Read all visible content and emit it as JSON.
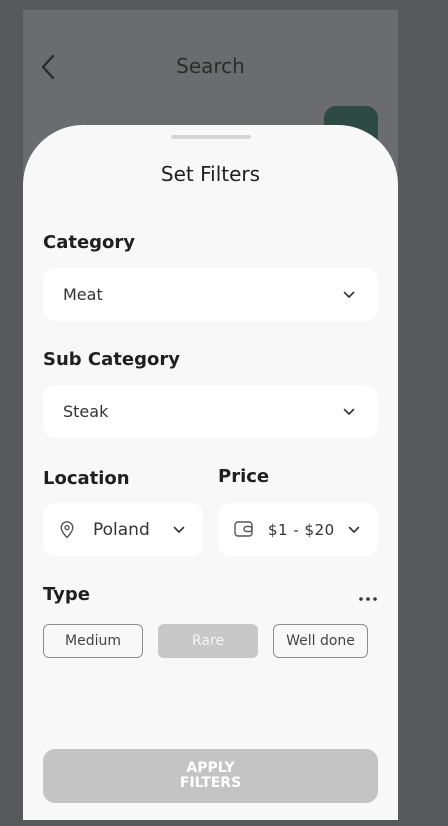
{
  "header": {
    "title": "Search"
  },
  "sheet": {
    "title": "Set Filters",
    "category": {
      "label": "Category",
      "value": "Meat"
    },
    "sub_category": {
      "label": "Sub Category",
      "value": "Steak"
    },
    "location": {
      "label": "Location",
      "value": "Poland"
    },
    "price": {
      "label": "Price",
      "value": "$1 - $20"
    },
    "type": {
      "label": "Type",
      "options": [
        "Medium",
        "Rare",
        "Well done"
      ],
      "selected": "Rare"
    },
    "apply_label": "APPLY\nFILTERS"
  },
  "colors": {
    "backdrop": "#57595c",
    "sheet": "#f8f8f8",
    "accent_dark": "#2d4a44",
    "chip_active": "#c8c8c8",
    "button_disabled": "#c4c4c4"
  },
  "icons": [
    "chevron-left-icon",
    "chevron-down-icon",
    "map-pin-icon",
    "wallet-icon",
    "more-dots-icon"
  ]
}
